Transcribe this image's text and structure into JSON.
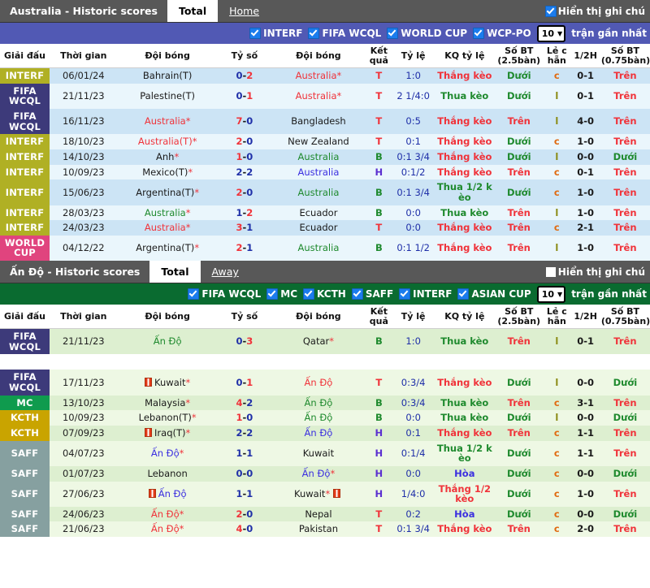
{
  "tables": [
    {
      "title": "Australia - Historic scores",
      "tabs": [
        {
          "label": "Total",
          "active": true
        },
        {
          "label": "Home",
          "active": false
        }
      ],
      "show_note_label": "Hiển thị ghi chú",
      "show_note_checked": true,
      "bar_color": "#5159b4",
      "filters": [
        {
          "label": "INTERF",
          "checked": true
        },
        {
          "label": "FIFA WCQL",
          "checked": true
        },
        {
          "label": "WORLD CUP",
          "checked": true
        },
        {
          "label": "WCP-PO",
          "checked": true
        }
      ],
      "count_value": "10",
      "count_suffix": "trận gần nhất",
      "columns": [
        "Giải đấu",
        "Thời gian",
        "Đội bóng",
        "Tỷ số",
        "Đội bóng",
        "Kết quả",
        "Tỷ lệ",
        "KQ tỷ lệ",
        "Số BT (2.5bàn)",
        "Lẻ c hẵn",
        "1/2H",
        "Số BT (0.75bàn)"
      ],
      "rows": [
        {
          "league": "INTERF",
          "lcolor": "#b0b024",
          "date": "06/01/24",
          "home": "Bahrain(T)",
          "hcolor": "c-dark",
          "hstar": false,
          "score": "0-2",
          "s1": "c-navy",
          "s2": "c-red",
          "away": "Australia",
          "acolor": "c-red",
          "astar": true,
          "kq": "T",
          "kqcolor": "c-red",
          "ty": "1:0",
          "tycolor": "c-navy",
          "kqty": "Thắng kèo",
          "kqtycolor": "c-red",
          "bt25": "Dưới",
          "bt25color": "c-green",
          "oe": "c",
          "oecolor": "c-orange",
          "h1": "0-1",
          "bt075": "Trên",
          "bt075color": "c-red",
          "bg": "#cce4f5"
        },
        {
          "league": "FIFA WCQL",
          "lcolor": "#3d3a7a",
          "date": "21/11/23",
          "home": "Palestine(T)",
          "hcolor": "c-dark",
          "hstar": false,
          "score": "0-1",
          "s1": "c-navy",
          "s2": "c-red",
          "away": "Australia",
          "acolor": "c-red",
          "astar": true,
          "kq": "T",
          "kqcolor": "c-red",
          "ty": "2 1/4:0",
          "tycolor": "c-navy",
          "kqty": "Thua kèo",
          "kqtycolor": "c-green",
          "bt25": "Dưới",
          "bt25color": "c-green",
          "oe": "l",
          "oecolor": "c-olive",
          "h1": "0-1",
          "bt075": "Trên",
          "bt075color": "c-red",
          "bg": "#eaf6fc"
        },
        {
          "league": "FIFA WCQL",
          "lcolor": "#3d3a7a",
          "date": "16/11/23",
          "home": "Australia",
          "hcolor": "c-red",
          "hstar": true,
          "score": "7-0",
          "s1": "c-red",
          "s2": "c-navy",
          "away": "Bangladesh",
          "acolor": "c-dark",
          "astar": false,
          "kq": "T",
          "kqcolor": "c-red",
          "ty": "0:5",
          "tycolor": "c-navy",
          "kqty": "Thắng kèo",
          "kqtycolor": "c-red",
          "bt25": "Trên",
          "bt25color": "c-red",
          "oe": "l",
          "oecolor": "c-olive",
          "h1": "4-0",
          "bt075": "Trên",
          "bt075color": "c-red",
          "bg": "#cce4f5"
        },
        {
          "league": "INTERF",
          "lcolor": "#b0b024",
          "date": "18/10/23",
          "home": "Australia(T)",
          "hcolor": "c-red",
          "hstar": true,
          "score": "2-0",
          "s1": "c-red",
          "s2": "c-navy",
          "away": "New Zealand",
          "acolor": "c-dark",
          "astar": false,
          "kq": "T",
          "kqcolor": "c-red",
          "ty": "0:1",
          "tycolor": "c-navy",
          "kqty": "Thắng kèo",
          "kqtycolor": "c-red",
          "bt25": "Dưới",
          "bt25color": "c-green",
          "oe": "c",
          "oecolor": "c-orange",
          "h1": "1-0",
          "bt075": "Trên",
          "bt075color": "c-red",
          "bg": "#eaf6fc"
        },
        {
          "league": "INTERF",
          "lcolor": "#b0b024",
          "date": "14/10/23",
          "home": "Anh",
          "hcolor": "c-dark",
          "hstar": true,
          "score": "1-0",
          "s1": "c-red",
          "s2": "c-navy",
          "away": "Australia",
          "acolor": "c-green",
          "astar": false,
          "kq": "B",
          "kqcolor": "c-green",
          "ty": "0:1 3/4",
          "tycolor": "c-navy",
          "kqty": "Thắng kèo",
          "kqtycolor": "c-red",
          "bt25": "Dưới",
          "bt25color": "c-green",
          "oe": "l",
          "oecolor": "c-olive",
          "h1": "0-0",
          "bt075": "Dưới",
          "bt075color": "c-green",
          "bg": "#cce4f5"
        },
        {
          "league": "INTERF",
          "lcolor": "#b0b024",
          "date": "10/09/23",
          "home": "Mexico(T)",
          "hcolor": "c-dark",
          "hstar": true,
          "score": "2-2",
          "s1": "c-navy",
          "s2": "c-navy",
          "away": "Australia",
          "acolor": "c-blue",
          "astar": false,
          "kq": "H",
          "kqcolor": "c-purple",
          "ty": "0:1/2",
          "tycolor": "c-navy",
          "kqty": "Thắng kèo",
          "kqtycolor": "c-red",
          "bt25": "Trên",
          "bt25color": "c-red",
          "oe": "c",
          "oecolor": "c-orange",
          "h1": "0-1",
          "bt075": "Trên",
          "bt075color": "c-red",
          "bg": "#eaf6fc"
        },
        {
          "league": "INTERF",
          "lcolor": "#b0b024",
          "date": "15/06/23",
          "home": "Argentina(T)",
          "hcolor": "c-dark",
          "hstar": true,
          "score": "2-0",
          "s1": "c-red",
          "s2": "c-navy",
          "away": "Australia",
          "acolor": "c-green",
          "astar": false,
          "kq": "B",
          "kqcolor": "c-green",
          "ty": "0:1 3/4",
          "tycolor": "c-navy",
          "kqty": "Thua 1/2 k èo",
          "kqtycolor": "c-green",
          "bt25": "Dưới",
          "bt25color": "c-green",
          "oe": "c",
          "oecolor": "c-orange",
          "h1": "1-0",
          "bt075": "Trên",
          "bt075color": "c-red",
          "bg": "#cce4f5"
        },
        {
          "league": "INTERF",
          "lcolor": "#b0b024",
          "date": "28/03/23",
          "home": "Australia",
          "hcolor": "c-green",
          "hstar": true,
          "score": "1-2",
          "s1": "c-navy",
          "s2": "c-red",
          "away": "Ecuador",
          "acolor": "c-dark",
          "astar": false,
          "kq": "B",
          "kqcolor": "c-green",
          "ty": "0:0",
          "tycolor": "c-navy",
          "kqty": "Thua kèo",
          "kqtycolor": "c-green",
          "bt25": "Trên",
          "bt25color": "c-red",
          "oe": "l",
          "oecolor": "c-olive",
          "h1": "1-0",
          "bt075": "Trên",
          "bt075color": "c-red",
          "bg": "#eaf6fc"
        },
        {
          "league": "INTERF",
          "lcolor": "#b0b024",
          "date": "24/03/23",
          "home": "Australia",
          "hcolor": "c-red",
          "hstar": true,
          "score": "3-1",
          "s1": "c-red",
          "s2": "c-navy",
          "away": "Ecuador",
          "acolor": "c-dark",
          "astar": false,
          "kq": "T",
          "kqcolor": "c-red",
          "ty": "0:0",
          "tycolor": "c-navy",
          "kqty": "Thắng kèo",
          "kqtycolor": "c-red",
          "bt25": "Trên",
          "bt25color": "c-red",
          "oe": "c",
          "oecolor": "c-orange",
          "h1": "2-1",
          "bt075": "Trên",
          "bt075color": "c-red",
          "bg": "#cce4f5"
        },
        {
          "league": "WORLD CUP",
          "lcolor": "#e0447e",
          "date": "04/12/22",
          "home": "Argentina(T)",
          "hcolor": "c-dark",
          "hstar": true,
          "score": "2-1",
          "s1": "c-red",
          "s2": "c-navy",
          "away": "Australia",
          "acolor": "c-green",
          "astar": false,
          "kq": "B",
          "kqcolor": "c-green",
          "ty": "0:1 1/2",
          "tycolor": "c-navy",
          "kqty": "Thắng kèo",
          "kqtycolor": "c-red",
          "bt25": "Trên",
          "bt25color": "c-red",
          "oe": "l",
          "oecolor": "c-olive",
          "h1": "1-0",
          "bt075": "Trên",
          "bt075color": "c-red",
          "bg": "#eaf6fc"
        }
      ]
    },
    {
      "title": "Ấn Độ - Historic scores",
      "tabs": [
        {
          "label": "Total",
          "active": true
        },
        {
          "label": "Away",
          "active": false
        }
      ],
      "show_note_label": "Hiển thị ghi chú",
      "show_note_checked": false,
      "bar_color": "#0a6b30",
      "filters": [
        {
          "label": "FIFA WCQL",
          "checked": true
        },
        {
          "label": "MC",
          "checked": true
        },
        {
          "label": "KCTH",
          "checked": true
        },
        {
          "label": "SAFF",
          "checked": true
        },
        {
          "label": "INTERF",
          "checked": true
        },
        {
          "label": "ASIAN CUP",
          "checked": true
        }
      ],
      "count_value": "10",
      "count_suffix": "trận gần nhất",
      "columns": [
        "Giải đấu",
        "Thời gian",
        "Đội bóng",
        "Tỷ số",
        "Đội bóng",
        "Kết quả",
        "Tỷ lệ",
        "KQ tỷ lệ",
        "Số BT (2.5bàn)",
        "Lẻ c hẵn",
        "1/2H",
        "Số BT (0.75bàn)"
      ],
      "rows": [
        {
          "league": "FIFA WCQL",
          "lcolor": "#3d3a7a",
          "date": "21/11/23",
          "home": "Ấn Độ",
          "hcolor": "c-green",
          "hstar": false,
          "score": "0-3",
          "s1": "c-navy",
          "s2": "c-red",
          "away": "Qatar",
          "acolor": "c-dark",
          "astar": true,
          "kq": "B",
          "kqcolor": "c-green",
          "ty": "1:0",
          "tycolor": "c-navy",
          "kqty": "Thua kèo",
          "kqtycolor": "c-green",
          "bt25": "Trên",
          "bt25color": "c-red",
          "oe": "l",
          "oecolor": "c-olive",
          "h1": "0-1",
          "bt075": "Trên",
          "bt075color": "c-red",
          "bg": "#ddefd0"
        },
        {
          "blank": true
        },
        {
          "league": "FIFA WCQL",
          "lcolor": "#3d3a7a",
          "date": "17/11/23",
          "home": "Kuwait",
          "hcolor": "c-dark",
          "hstar": true,
          "hflag": true,
          "score": "0-1",
          "s1": "c-navy",
          "s2": "c-red",
          "away": "Ấn Độ",
          "acolor": "c-red",
          "astar": false,
          "kq": "T",
          "kqcolor": "c-red",
          "ty": "0:3/4",
          "tycolor": "c-navy",
          "kqty": "Thắng kèo",
          "kqtycolor": "c-red",
          "bt25": "Dưới",
          "bt25color": "c-green",
          "oe": "l",
          "oecolor": "c-olive",
          "h1": "0-0",
          "bt075": "Dưới",
          "bt075color": "c-green",
          "bg": "#eef8e4"
        },
        {
          "league": "MC",
          "lcolor": "#0f9b4e",
          "date": "13/10/23",
          "home": "Malaysia",
          "hcolor": "c-dark",
          "hstar": true,
          "score": "4-2",
          "s1": "c-red",
          "s2": "c-navy",
          "away": "Ấn Độ",
          "acolor": "c-green",
          "astar": false,
          "kq": "B",
          "kqcolor": "c-green",
          "ty": "0:3/4",
          "tycolor": "c-navy",
          "kqty": "Thua kèo",
          "kqtycolor": "c-green",
          "bt25": "Trên",
          "bt25color": "c-red",
          "oe": "c",
          "oecolor": "c-orange",
          "h1": "3-1",
          "bt075": "Trên",
          "bt075color": "c-red",
          "bg": "#ddefd0"
        },
        {
          "league": "KCTH",
          "lcolor": "#c9a400",
          "date": "10/09/23",
          "home": "Lebanon(T)",
          "hcolor": "c-dark",
          "hstar": true,
          "score": "1-0",
          "s1": "c-red",
          "s2": "c-navy",
          "away": "Ấn Độ",
          "acolor": "c-green",
          "astar": false,
          "kq": "B",
          "kqcolor": "c-green",
          "ty": "0:0",
          "tycolor": "c-navy",
          "kqty": "Thua kèo",
          "kqtycolor": "c-green",
          "bt25": "Dưới",
          "bt25color": "c-green",
          "oe": "l",
          "oecolor": "c-olive",
          "h1": "0-0",
          "bt075": "Dưới",
          "bt075color": "c-green",
          "bg": "#eef8e4"
        },
        {
          "league": "KCTH",
          "lcolor": "#c9a400",
          "date": "07/09/23",
          "home": "Iraq(T)",
          "hcolor": "c-dark",
          "hstar": true,
          "hflag": true,
          "score": "2-2",
          "s1": "c-navy",
          "s2": "c-navy",
          "away": "Ấn Độ",
          "acolor": "c-blue",
          "astar": false,
          "kq": "H",
          "kqcolor": "c-purple",
          "ty": "0:1",
          "tycolor": "c-navy",
          "kqty": "Thắng kèo",
          "kqtycolor": "c-red",
          "bt25": "Trên",
          "bt25color": "c-red",
          "oe": "c",
          "oecolor": "c-orange",
          "h1": "1-1",
          "bt075": "Trên",
          "bt075color": "c-red",
          "bg": "#ddefd0"
        },
        {
          "league": "SAFF",
          "lcolor": "#86a0a0",
          "date": "04/07/23",
          "home": "Ấn Độ",
          "hcolor": "c-blue",
          "hstar": true,
          "score": "1-1",
          "s1": "c-navy",
          "s2": "c-navy",
          "away": "Kuwait",
          "acolor": "c-dark",
          "astar": false,
          "kq": "H",
          "kqcolor": "c-purple",
          "ty": "0:1/4",
          "tycolor": "c-navy",
          "kqty": "Thua 1/2 k èo",
          "kqtycolor": "c-green",
          "bt25": "Dưới",
          "bt25color": "c-green",
          "oe": "c",
          "oecolor": "c-orange",
          "h1": "1-1",
          "bt075": "Trên",
          "bt075color": "c-red",
          "bg": "#eef8e4"
        },
        {
          "league": "SAFF",
          "lcolor": "#86a0a0",
          "date": "01/07/23",
          "home": "Lebanon",
          "hcolor": "c-dark",
          "hstar": false,
          "score": "0-0",
          "s1": "c-navy",
          "s2": "c-navy",
          "away": "Ấn Độ",
          "acolor": "c-blue",
          "astar": true,
          "kq": "H",
          "kqcolor": "c-purple",
          "ty": "0:0",
          "tycolor": "c-navy",
          "kqty": "Hòa",
          "kqtycolor": "c-blue",
          "bt25": "Dưới",
          "bt25color": "c-green",
          "oe": "c",
          "oecolor": "c-orange",
          "h1": "0-0",
          "bt075": "Dưới",
          "bt075color": "c-green",
          "bg": "#ddefd0"
        },
        {
          "league": "SAFF",
          "lcolor": "#86a0a0",
          "date": "27/06/23",
          "home": "Ấn Độ",
          "hcolor": "c-blue",
          "hstar": false,
          "hflag": true,
          "score": "1-1",
          "s1": "c-navy",
          "s2": "c-navy",
          "away": "Kuwait",
          "acolor": "c-dark",
          "astar": true,
          "aflag": true,
          "kq": "H",
          "kqcolor": "c-purple",
          "ty": "1/4:0",
          "tycolor": "c-navy",
          "kqty": "Thắng 1/2 kèo",
          "kqtycolor": "c-red",
          "bt25": "Dưới",
          "bt25color": "c-green",
          "oe": "c",
          "oecolor": "c-orange",
          "h1": "1-0",
          "bt075": "Trên",
          "bt075color": "c-red",
          "bg": "#eef8e4"
        },
        {
          "league": "SAFF",
          "lcolor": "#86a0a0",
          "date": "24/06/23",
          "home": "Ấn Độ",
          "hcolor": "c-red",
          "hstar": true,
          "score": "2-0",
          "s1": "c-red",
          "s2": "c-navy",
          "away": "Nepal",
          "acolor": "c-dark",
          "astar": false,
          "kq": "T",
          "kqcolor": "c-red",
          "ty": "0:2",
          "tycolor": "c-navy",
          "kqty": "Hòa",
          "kqtycolor": "c-blue",
          "bt25": "Dưới",
          "bt25color": "c-green",
          "oe": "c",
          "oecolor": "c-orange",
          "h1": "0-0",
          "bt075": "Dưới",
          "bt075color": "c-green",
          "bg": "#ddefd0"
        },
        {
          "league": "SAFF",
          "lcolor": "#86a0a0",
          "date": "21/06/23",
          "home": "Ấn Độ",
          "hcolor": "c-red",
          "hstar": true,
          "score": "4-0",
          "s1": "c-red",
          "s2": "c-navy",
          "away": "Pakistan",
          "acolor": "c-dark",
          "astar": false,
          "kq": "T",
          "kqcolor": "c-red",
          "ty": "0:1 3/4",
          "tycolor": "c-navy",
          "kqty": "Thắng kèo",
          "kqtycolor": "c-red",
          "bt25": "Trên",
          "bt25color": "c-red",
          "oe": "c",
          "oecolor": "c-orange",
          "h1": "2-0",
          "bt075": "Trên",
          "bt075color": "c-red",
          "bg": "#eef8e4"
        }
      ]
    }
  ]
}
